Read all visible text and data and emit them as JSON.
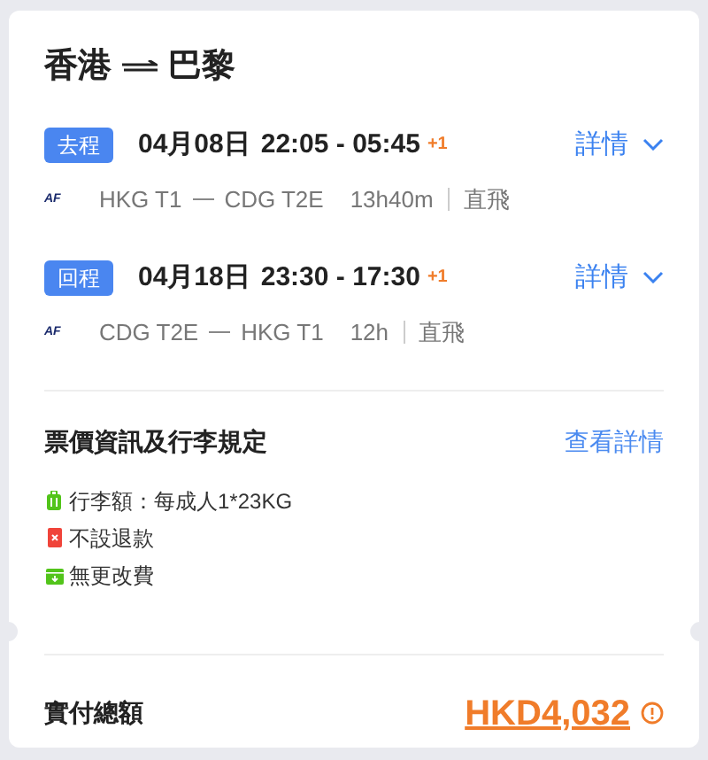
{
  "title": {
    "origin": "香港",
    "destination": "巴黎"
  },
  "segments": [
    {
      "tag": "去程",
      "date": "04月08日",
      "times": "22:05 - 05:45",
      "day_offset": "+1",
      "details": "詳情",
      "logo": "AF",
      "route_from": "HKG T1",
      "route_to": "CDG T2E",
      "duration": "13h40m",
      "stops": "直飛"
    },
    {
      "tag": "回程",
      "date": "04月18日",
      "times": "23:30 - 17:30",
      "day_offset": "+1",
      "details": "詳情",
      "logo": "AF",
      "route_from": "CDG T2E",
      "route_to": "HKG T1",
      "duration": "12h",
      "stops": "直飛"
    }
  ],
  "fare_rules": {
    "heading": "票價資訊及行李規定",
    "link": "查看詳情",
    "items": [
      {
        "kind": "baggage",
        "text": "行李額：每成人1*23KG"
      },
      {
        "kind": "refund",
        "text": "不設退款"
      },
      {
        "kind": "change",
        "text": "無更改費"
      }
    ]
  },
  "total": {
    "label": "實付總額",
    "amount": "HKD4,032"
  }
}
